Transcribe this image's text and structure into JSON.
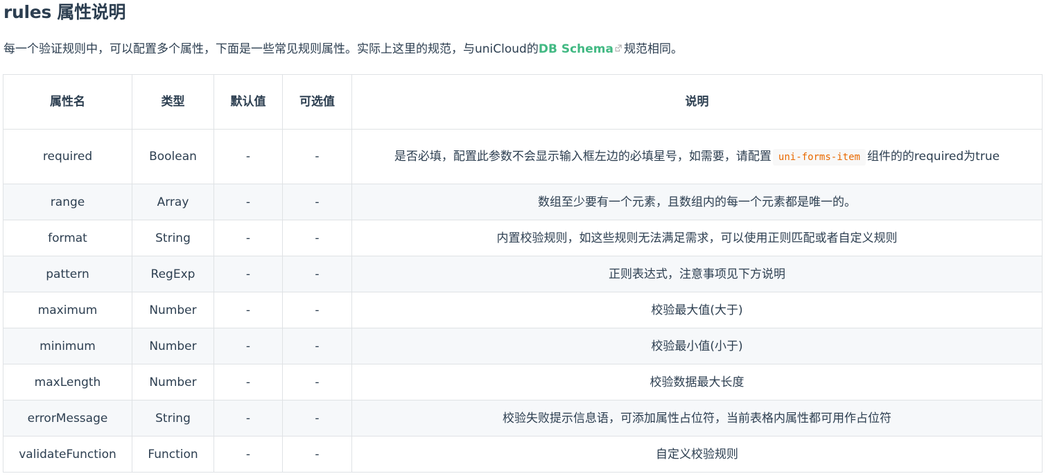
{
  "heading": "rules 属性说明",
  "intro": {
    "before": "每一个验证规则中，可以配置多个属性，下面是一些常见规则属性。实际上这里的规范，与uniCloud的",
    "link": "DB Schema",
    "after": "规范相同。"
  },
  "table": {
    "headers": {
      "name": "属性名",
      "type": "类型",
      "default": "默认值",
      "options": "可选值",
      "desc": "说明"
    },
    "rows": [
      {
        "name": "required",
        "type": "Boolean",
        "default": "-",
        "options": "-",
        "desc_before": "是否必填，配置此参数不会显示输入框左边的必填星号，如需要，请配置",
        "desc_code": "uni-forms-item",
        "desc_after": "组件的的required为true"
      },
      {
        "name": "range",
        "type": "Array",
        "default": "-",
        "options": "-",
        "desc": "数组至少要有一个元素，且数组内的每一个元素都是唯一的。"
      },
      {
        "name": "format",
        "type": "String",
        "default": "-",
        "options": "-",
        "desc": "内置校验规则，如这些规则无法满足需求，可以使用正则匹配或者自定义规则"
      },
      {
        "name": "pattern",
        "type": "RegExp",
        "default": "-",
        "options": "-",
        "desc": "正则表达式，注意事项见下方说明"
      },
      {
        "name": "maximum",
        "type": "Number",
        "default": "-",
        "options": "-",
        "desc": "校验最大值(大于)"
      },
      {
        "name": "minimum",
        "type": "Number",
        "default": "-",
        "options": "-",
        "desc": "校验最小值(小于)"
      },
      {
        "name": "maxLength",
        "type": "Number",
        "default": "-",
        "options": "-",
        "desc": "校验数据最大长度"
      },
      {
        "name": "errorMessage",
        "type": "String",
        "default": "-",
        "options": "-",
        "desc": "校验失败提示信息语，可添加属性占位符，当前表格内属性都可用作占位符"
      },
      {
        "name": "validateFunction",
        "type": "Function",
        "default": "-",
        "options": "-",
        "desc": "自定义校验规则"
      }
    ]
  },
  "colors": {
    "text": "#2c3e50",
    "link": "#42b983",
    "code": "#e96900",
    "border": "#dfe2e5",
    "row_alt": "#f6f8fa"
  },
  "icons": {
    "external_link": "external-link-icon"
  }
}
